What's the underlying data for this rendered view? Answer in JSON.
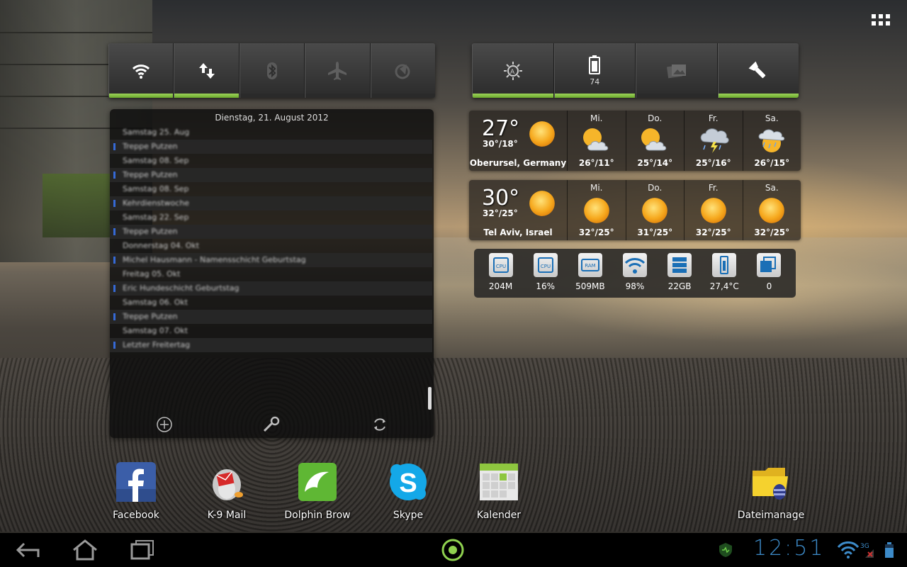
{
  "toggles_left": [
    {
      "name": "wifi-icon",
      "on": true
    },
    {
      "name": "data-sync-icon",
      "on": true
    },
    {
      "name": "bluetooth-icon",
      "on": false
    },
    {
      "name": "airplane-icon",
      "on": false
    },
    {
      "name": "gps-icon",
      "on": false
    }
  ],
  "toggles_right": [
    {
      "name": "auto-brightness-icon",
      "on": true
    },
    {
      "name": "battery-icon",
      "on": true,
      "value": "74"
    },
    {
      "name": "gallery-icon",
      "on": false
    },
    {
      "name": "flashlight-icon",
      "on": true
    }
  ],
  "calendar": {
    "date_header": "Dienstag, 21. August 2012",
    "rows": [
      {
        "text": "Samstag 25. Aug",
        "event": false
      },
      {
        "text": "Treppe Putzen",
        "event": true
      },
      {
        "text": "Samstag 08. Sep",
        "event": false
      },
      {
        "text": "Treppe Putzen",
        "event": true
      },
      {
        "text": "Samstag 08. Sep",
        "event": false
      },
      {
        "text": "Kehrdienstwoche",
        "event": true
      },
      {
        "text": "Samstag 22. Sep",
        "event": false
      },
      {
        "text": "Treppe Putzen",
        "event": true
      },
      {
        "text": "Donnerstag 04. Okt",
        "event": false
      },
      {
        "text": "Michel Hausmann - Namensschicht Geburtstag",
        "event": true
      },
      {
        "text": "Freitag 05. Okt",
        "event": false
      },
      {
        "text": "Eric Hundeschicht Geburtstag",
        "event": true
      },
      {
        "text": "Samstag 06. Okt",
        "event": false
      },
      {
        "text": "Treppe Putzen",
        "event": true
      },
      {
        "text": "Samstag 07. Okt",
        "event": false
      },
      {
        "text": "Letzter Freitertag",
        "event": true
      }
    ]
  },
  "weather": [
    {
      "current_temp": "27°",
      "hi_lo": "30°/18°",
      "city": "Oberursel, Germany",
      "days": [
        {
          "name": "Mi.",
          "temp": "26°/11°",
          "icon": "sun-cloud-icon"
        },
        {
          "name": "Do.",
          "temp": "25°/14°",
          "icon": "sun-cloud-icon"
        },
        {
          "name": "Fr.",
          "temp": "25°/16°",
          "icon": "thunderstorm-icon"
        },
        {
          "name": "Sa.",
          "temp": "26°/15°",
          "icon": "sun-rain-icon"
        }
      ]
    },
    {
      "current_temp": "30°",
      "hi_lo": "32°/25°",
      "city": "Tel Aviv, Israel",
      "days": [
        {
          "name": "Mi.",
          "temp": "32°/25°",
          "icon": "sun-icon"
        },
        {
          "name": "Do.",
          "temp": "31°/25°",
          "icon": "sun-icon"
        },
        {
          "name": "Fr.",
          "temp": "32°/25°",
          "icon": "sun-icon"
        },
        {
          "name": "Sa.",
          "temp": "32°/25°",
          "icon": "sun-icon"
        }
      ]
    }
  ],
  "stats": [
    {
      "icon": "cpu-icon",
      "label": "CPU",
      "value": "204M"
    },
    {
      "icon": "cpu-load-icon",
      "label": "CPU",
      "value": "16%"
    },
    {
      "icon": "ram-icon",
      "label": "RAM",
      "value": "509MB"
    },
    {
      "icon": "wifi-signal-icon",
      "label": "",
      "value": "98%"
    },
    {
      "icon": "storage-icon",
      "label": "",
      "value": "22GB"
    },
    {
      "icon": "battery-temp-icon",
      "label": "",
      "value": "27,4°C"
    },
    {
      "icon": "tasks-icon",
      "label": "",
      "value": "0"
    }
  ],
  "apps": [
    {
      "label": "Facebook",
      "icon": "facebook-icon"
    },
    {
      "label": "K-9 Mail",
      "icon": "k9-mail-icon"
    },
    {
      "label": "Dolphin Brow",
      "icon": "dolphin-browser-icon"
    },
    {
      "label": "Skype",
      "icon": "skype-icon"
    },
    {
      "label": "Kalender",
      "icon": "calendar-app-icon"
    },
    {
      "label": "Dateimanage",
      "icon": "file-manager-icon"
    }
  ],
  "statusbar": {
    "time": "12:51",
    "network": "3G"
  },
  "colors": {
    "toggle_on": "#7cc23a",
    "clock": "#3d8bc9",
    "calendar_event": "#3569d6"
  }
}
